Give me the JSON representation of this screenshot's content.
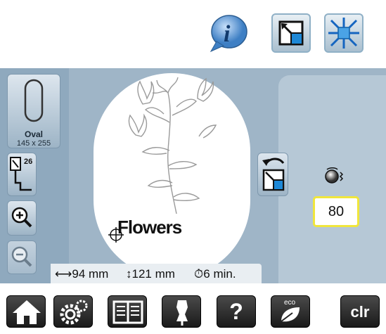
{
  "hoop": {
    "name": "Oval",
    "size": "145 x 255"
  },
  "presser_foot": {
    "number": "26"
  },
  "design": {
    "name": "Flowers"
  },
  "speed": {
    "value": "80"
  },
  "status": {
    "width": "94 mm",
    "height": "121 mm",
    "time": "6 min."
  },
  "bottom": {
    "help_label": "?",
    "eco_label": "eco",
    "clr_label": "clr"
  },
  "colors": {
    "panel": "#9fb5c7",
    "highlight": "#f0e63c",
    "bar": "#1a1a1a"
  }
}
